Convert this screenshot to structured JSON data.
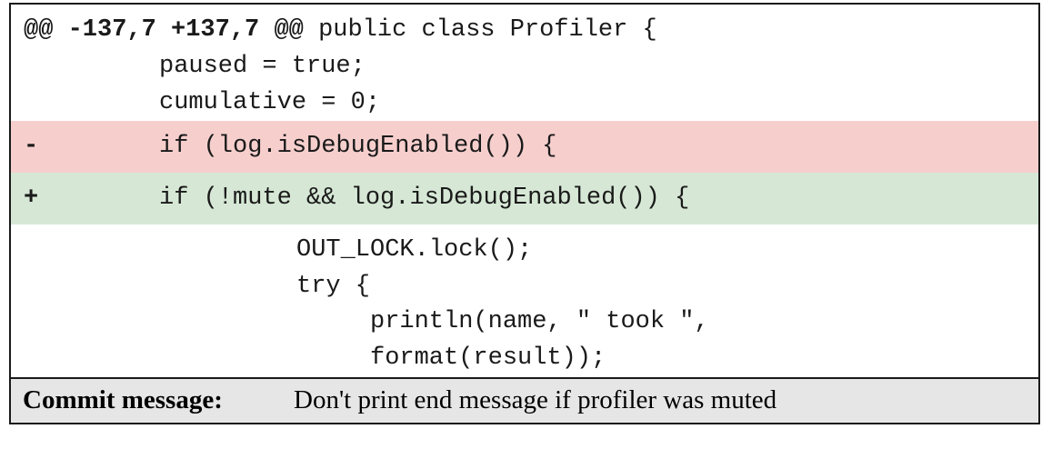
{
  "diff": {
    "hunk_header": {
      "marker_open": "@@",
      "range": "-137,7 +137,7",
      "marker_close": "@@",
      "context": "public class Profiler {"
    },
    "lines": [
      {
        "type": "context",
        "marker": "",
        "indent": 2,
        "code": "paused = true;"
      },
      {
        "type": "context",
        "marker": "",
        "indent": 2,
        "code": "cumulative = 0;"
      },
      {
        "type": "removed",
        "marker": "-",
        "indent": 2,
        "code": "if (log.isDebugEnabled()) {"
      },
      {
        "type": "added",
        "marker": "+",
        "indent": 2,
        "code": "if (!mute && log.isDebugEnabled()) {"
      },
      {
        "type": "context",
        "marker": "",
        "indent": 4,
        "code": "OUT_LOCK.lock();"
      },
      {
        "type": "context",
        "marker": "",
        "indent": 4,
        "code": "try {"
      },
      {
        "type": "context",
        "marker": "",
        "indent": 5,
        "code": "println(name, \" took \","
      },
      {
        "type": "context",
        "marker": "",
        "indent": 5,
        "code": "format(result));"
      }
    ],
    "colors": {
      "removed_bg": "#f6cfcd",
      "added_bg": "#d6e8d5",
      "commit_bg": "#e6e6e6"
    }
  },
  "commit": {
    "label": "Commit message:",
    "message": "Don't print end message if profiler was muted"
  }
}
